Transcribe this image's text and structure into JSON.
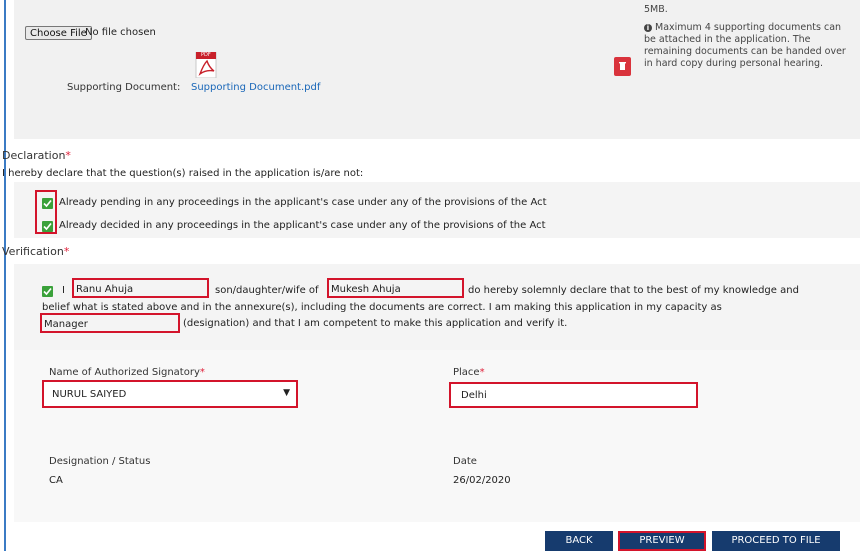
{
  "upload": {
    "choose_label": "Choose File",
    "no_file": "No file chosen",
    "supporting_label": "Supporting Document:",
    "supporting_link": "Supporting Document.pdf",
    "pdf_badge": "PDF",
    "note_top": "5MB.",
    "note_icon": "info-icon",
    "note_text": "Maximum 4 supporting documents can be attached in the application. The remaining documents can be handed over in hard copy during personal hearing."
  },
  "declaration": {
    "title": "Declaration",
    "required_mark": "*",
    "intro": "I hereby declare that the question(s) raised in the application is/are not:",
    "items": [
      {
        "label": "Already pending in any proceedings in the applicant's case under any of the provisions of the Act",
        "checked": true
      },
      {
        "label": "Already decided in any proceedings in the applicant's case under any of the provisions of the Act",
        "checked": true
      }
    ]
  },
  "verification": {
    "title": "Verification",
    "required_mark": "*",
    "prefix": "I",
    "name": "Ranu Ahuja",
    "relation": "son/daughter/wife of",
    "parent": "Mukesh Ahuja",
    "text1": "do hereby solemnly declare that to the best of my knowledge and",
    "text2": "belief what is stated above and in the annexure(s), including the documents are correct. I am making this application in my capacity as",
    "designation": "Manager",
    "text3": "(designation) and that I am competent to make this application and verify it."
  },
  "form": {
    "signatory_label": "Name of Authorized Signatory",
    "signatory_value": "NURUL SAIYED",
    "place_label": "Place",
    "place_value": "Delhi",
    "designation_label": "Designation / Status",
    "designation_value": "CA",
    "date_label": "Date",
    "date_value": "26/02/2020",
    "required_mark": "*"
  },
  "buttons": {
    "back": "BACK",
    "preview": "PREVIEW",
    "proceed": "PROCEED TO FILE"
  },
  "colors": {
    "accent": "#163b6e",
    "highlight": "#d3142b",
    "checkbox": "#3aa13a",
    "delete": "#d9333c",
    "link": "#1a67b8"
  }
}
